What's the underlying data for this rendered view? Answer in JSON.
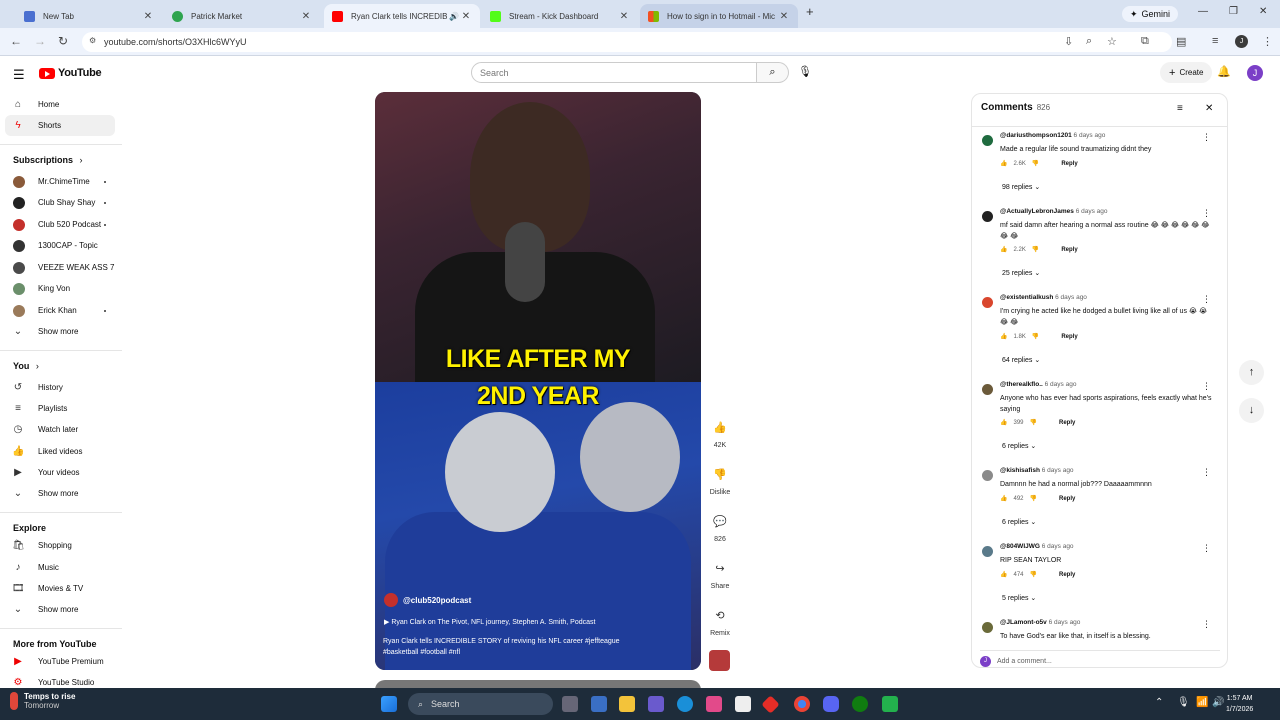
{
  "browser": {
    "tabs": [
      {
        "title": "New Tab",
        "favicon_color": "#4a6fd0"
      },
      {
        "title": "Patrick Market",
        "favicon_color": "#2fa44f"
      },
      {
        "title": "Ryan Clark tells INCREDIBLE",
        "favicon_color": "#ff0000"
      },
      {
        "title": "Stream - Kick Dashboard",
        "favicon_color": "#53fc18"
      },
      {
        "title": "How to sign in to Hotmail - Mic",
        "favicon_color": "#f25022"
      }
    ],
    "gemini_label": "Gemini",
    "url": "youtube.com/shorts/O3XHlc6WYyU"
  },
  "youtube": {
    "logo_text": "YouTube",
    "search_placeholder": "Search",
    "create_label": "Create",
    "avatar_letter": "J"
  },
  "sidebar": {
    "main": [
      {
        "label": "Home",
        "icon": "home-icon"
      },
      {
        "label": "Shorts",
        "icon": "shorts-icon"
      }
    ],
    "subscriptions_title": "Subscriptions",
    "subscriptions": [
      {
        "label": "Mr.ChimeTime",
        "color": "#8a5a3a",
        "dot": true
      },
      {
        "label": "Club Shay Shay",
        "color": "#222222",
        "dot": true
      },
      {
        "label": "Club 520 Podcast",
        "color": "#c4302b",
        "dot": true
      },
      {
        "label": "1300CAP - Topic",
        "color": "#333333",
        "dot": false
      },
      {
        "label": "VEEZE WEAK ASS 7",
        "color": "#4a4a4a",
        "dot": false
      },
      {
        "label": "King Von",
        "color": "#6b8f6b",
        "dot": false
      },
      {
        "label": "Erick Khan",
        "color": "#9a7a5a",
        "dot": true
      }
    ],
    "show_more": "Show more",
    "you_title": "You",
    "you_items": [
      {
        "label": "History",
        "icon": "history-icon"
      },
      {
        "label": "Playlists",
        "icon": "playlists-icon"
      },
      {
        "label": "Watch later",
        "icon": "watch-later-icon"
      },
      {
        "label": "Liked videos",
        "icon": "liked-videos-icon"
      },
      {
        "label": "Your videos",
        "icon": "your-videos-icon"
      }
    ],
    "explore_title": "Explore",
    "explore_items": [
      {
        "label": "Shopping",
        "icon": "shopping-icon"
      },
      {
        "label": "Music",
        "icon": "music-icon"
      },
      {
        "label": "Movies & TV",
        "icon": "movies-icon"
      }
    ],
    "more_title": "More from YouTube",
    "more_items": [
      {
        "label": "YouTube Premium",
        "icon": "premium-icon"
      },
      {
        "label": "YouTube Studio",
        "icon": "studio-icon"
      }
    ]
  },
  "short": {
    "caption_line1": "LIKE AFTER MY",
    "caption_line2": "2ND YEAR",
    "channel": "@club520podcast",
    "related": "Ryan Clark on The Pivot, NFL journey, Stephen A. Smith, Podcast",
    "title": "Ryan Clark tells INCREDIBLE STORY of reviving his NFL career #jeffteague #basketball #football #nfl",
    "actions": {
      "likes": "42K",
      "dislike": "Dislike",
      "comments": "826",
      "share": "Share",
      "remix": "Remix"
    }
  },
  "comments": {
    "title": "Comments",
    "count": "826",
    "add_placeholder": "Add a comment...",
    "items": [
      {
        "user": "@dariusthompson1201",
        "time": "6 days ago",
        "text": "Made a regular life sound traumatizing didnt they",
        "likes": "2.6K",
        "replies": "98 replies",
        "color": "#1f6b3f"
      },
      {
        "user": "@ActuallyLebronJames",
        "time": "6 days ago",
        "text": "mf said damn after hearing a normal ass routine 😂 😂 😂 😂 😂 😂 😂 😂",
        "likes": "2.2K",
        "replies": "25 replies",
        "color": "#222222"
      },
      {
        "user": "@existentialkush",
        "time": "6 days ago",
        "text": "I'm crying he acted like he dodged a bullet living like all of us 😭 😭 😂 😂",
        "likes": "1.8K",
        "replies": "64 replies",
        "color": "#d9462d"
      },
      {
        "user": "@therealkflo..",
        "time": "6 days ago",
        "text": "Anyone who has ever had sports aspirations, feels exactly what he's saying",
        "likes": "399",
        "replies": "6 replies",
        "color": "#6b5a3a"
      },
      {
        "user": "@kishisafish",
        "time": "6 days ago",
        "text": "Damnnn he had a normal job??? Daaaaammnnn",
        "likes": "492",
        "replies": "6 replies",
        "color": "#8a8a8a"
      },
      {
        "user": "@804WIJWG",
        "time": "6 days ago",
        "text": "RIP SEAN TAYLOR",
        "likes": "474",
        "replies": "5 replies",
        "color": "#5a7a8a"
      },
      {
        "user": "@JLamont-o5v",
        "time": "6 days ago",
        "text": "To have God's ear like that, in itself is a blessing.",
        "likes": "",
        "replies": "",
        "color": "#6a6a3a"
      }
    ],
    "reply_label": "Reply"
  },
  "taskbar": {
    "weather_line1": "Temps to rise",
    "weather_line2": "Tomorrow",
    "search_label": "Search",
    "time": "1:57 AM",
    "date": "1/7/2026"
  }
}
